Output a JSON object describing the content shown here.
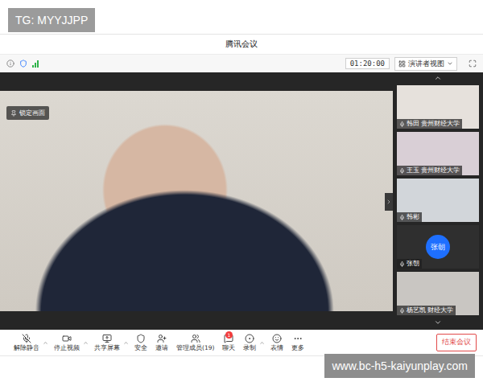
{
  "watermarks": [
    {
      "text": "TG: MYYJJPP",
      "place": "top"
    },
    {
      "text": "www.bc-h5-kaiyunplay.com",
      "place": "bottom"
    }
  ],
  "window": {
    "title": "腾讯会议"
  },
  "info_bar": {
    "timer": "01:20:00",
    "view_menu": "演讲者视图"
  },
  "stage": {
    "pin_button": "锁定画面"
  },
  "participants": [
    {
      "kind": "video",
      "label": "韩田 贵州财经大学",
      "avatar_text": "",
      "color": "#e6e1dc"
    },
    {
      "kind": "video",
      "label": "王玉 贵州财经大学",
      "avatar_text": "",
      "color": "#d9cfd6"
    },
    {
      "kind": "video",
      "label": "韩彬",
      "avatar_text": "",
      "color": "#d2d6da"
    },
    {
      "kind": "avatar",
      "label": "张朝",
      "avatar_text": "张朝",
      "color": "#2f2f2f"
    },
    {
      "kind": "video",
      "label": "杨艺凯 财经大学",
      "avatar_text": "",
      "color": "#c9c6c2"
    }
  ],
  "toolbar": {
    "items": [
      {
        "label": "解除静音",
        "menu": true,
        "badge": ""
      },
      {
        "label": "停止视频",
        "menu": true,
        "badge": ""
      },
      {
        "label": "共享屏幕",
        "menu": true,
        "badge": ""
      },
      {
        "label": "安全",
        "menu": false,
        "badge": ""
      },
      {
        "label": "邀请",
        "menu": false,
        "badge": ""
      },
      {
        "label": "管理成员(19)",
        "menu": false,
        "badge": ""
      },
      {
        "label": "聊天",
        "menu": false,
        "badge": "1"
      },
      {
        "label": "录制",
        "menu": true,
        "badge": ""
      },
      {
        "label": "表情",
        "menu": false,
        "badge": ""
      },
      {
        "label": "更多",
        "menu": false,
        "badge": ""
      }
    ],
    "end_button": "结束会议"
  }
}
